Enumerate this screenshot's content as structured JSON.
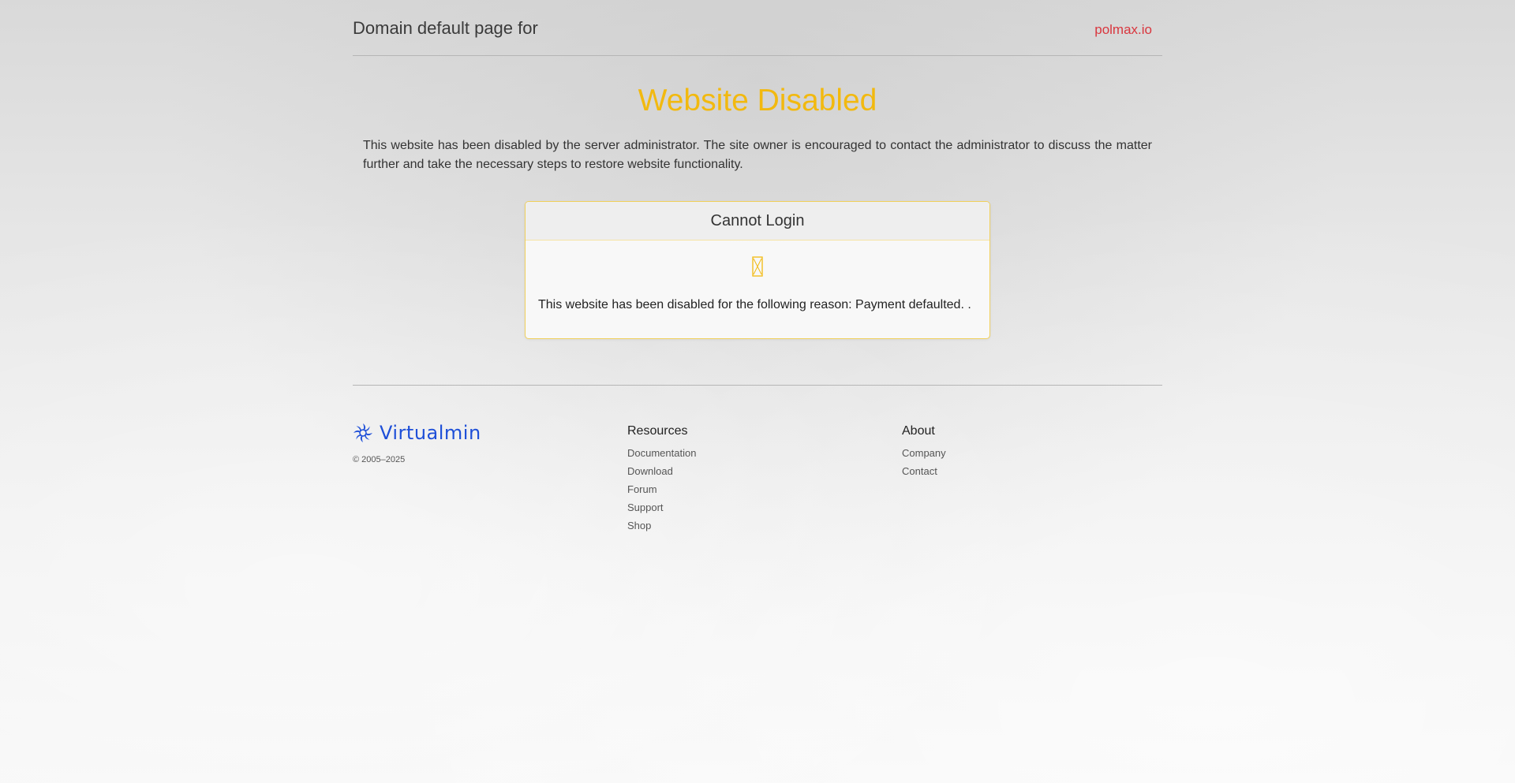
{
  "header": {
    "title": "Domain default page for",
    "domain": "polmax.io"
  },
  "main": {
    "title": "Website Disabled",
    "intro": "This website has been disabled by the server administrator. The site owner is encouraged to contact the administrator to discuss the matter further and take the necessary steps to restore website functionality."
  },
  "card": {
    "title": "Cannot Login",
    "icon": "hourglass-icon",
    "message": "This website has been disabled for the following reason: Payment defaulted. ."
  },
  "footer": {
    "logo_text": "Virtualmin",
    "copyright": "© 2005–2025",
    "resources": {
      "heading": "Resources",
      "links": [
        "Documentation",
        "Download",
        "Forum",
        "Support",
        "Shop"
      ]
    },
    "about": {
      "heading": "About",
      "links": [
        "Company",
        "Contact"
      ]
    }
  },
  "colors": {
    "accent": "#f2b90f",
    "domain_link": "#d9363e",
    "logo_blue": "#1e4fd8"
  }
}
